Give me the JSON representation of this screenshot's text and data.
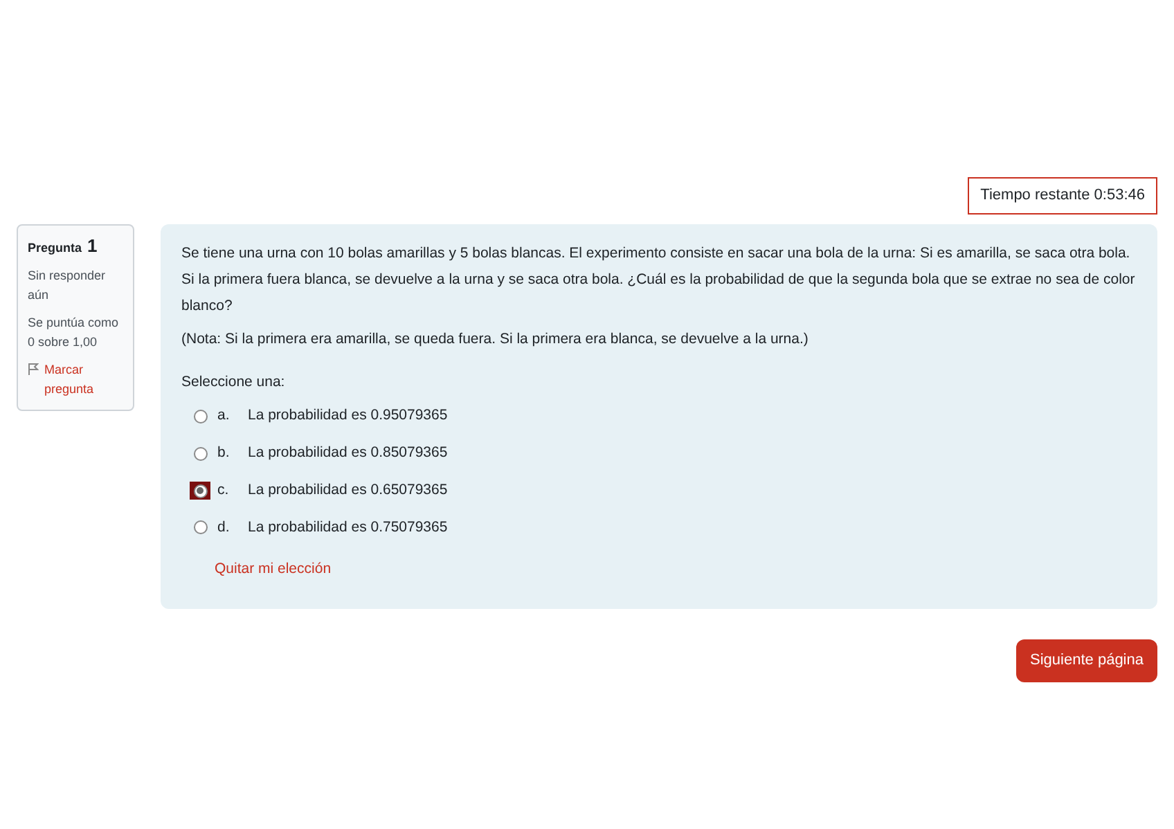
{
  "timer": {
    "label": "Tiempo restante 0:53:46"
  },
  "info": {
    "title": "Pregunta",
    "number": "1",
    "status": "Sin responder aún",
    "grade": "Se puntúa como 0 sobre 1,00",
    "flag": "Marcar pregunta"
  },
  "question": {
    "text": "Se tiene una urna con 10 bolas amarillas y 5 bolas blancas. El experimento consiste en sacar una bola de la urna: Si es amarilla, se saca otra bola. Si la primera fuera blanca, se devuelve a la urna y se saca otra bola. ¿Cuál es la probabilidad de que la segunda bola que se extrae no sea de color blanco?",
    "note": "(Nota: Si la primera era amarilla, se queda fuera. Si la primera era blanca, se devuelve a la urna.)",
    "prompt": "Seleccione una:",
    "options": [
      {
        "letter": "a.",
        "text": "La probabilidad es 0.95079365",
        "selected": false
      },
      {
        "letter": "b.",
        "text": "La probabilidad es 0.85079365",
        "selected": false
      },
      {
        "letter": "c.",
        "text": "La probabilidad es 0.65079365",
        "selected": true
      },
      {
        "letter": "d.",
        "text": "La probabilidad es 0.75079365",
        "selected": false
      }
    ],
    "clear": "Quitar mi elección"
  },
  "next_button": "Siguiente página"
}
